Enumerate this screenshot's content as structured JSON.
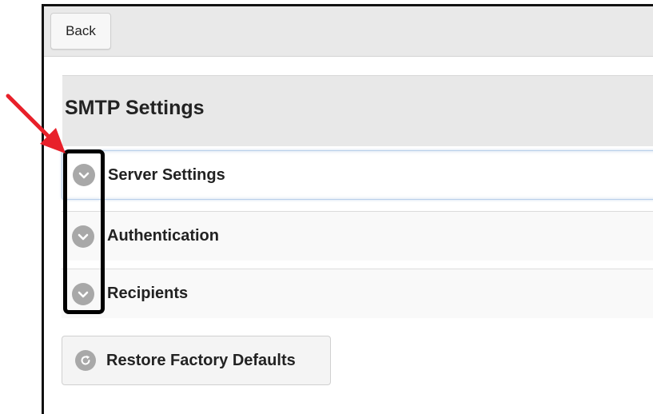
{
  "toolbar": {
    "back_label": "Back"
  },
  "page": {
    "title": "SMTP Settings"
  },
  "sections": [
    {
      "label": "Server Settings",
      "icon": "chevron-down-icon",
      "state": "active"
    },
    {
      "label": "Authentication",
      "icon": "chevron-down-icon",
      "state": "collapsed"
    },
    {
      "label": "Recipients",
      "icon": "chevron-down-icon",
      "state": "collapsed"
    }
  ],
  "actions": {
    "restore_label": "Restore Factory Defaults",
    "restore_icon": "refresh-icon"
  },
  "annotations": {
    "arrow_color": "#e8202a",
    "highlight_color": "#000000"
  },
  "colors": {
    "icon_gray": "#a8a8a8",
    "panel_gray": "#e8e8e8",
    "active_border": "#b9d0ea"
  }
}
